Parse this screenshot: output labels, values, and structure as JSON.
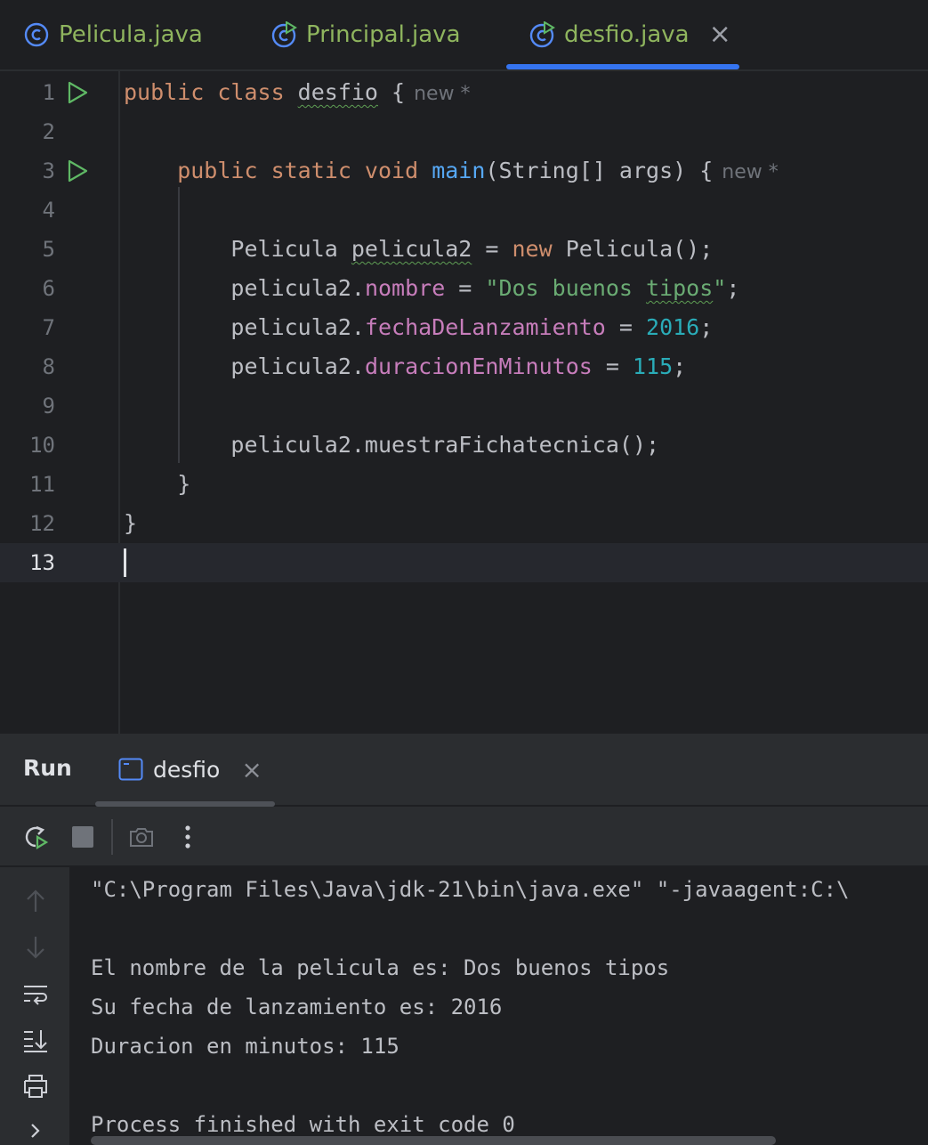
{
  "editor_tabs": [
    {
      "label": "Pelicula.java",
      "icon": "class-icon"
    },
    {
      "label": "Principal.java",
      "icon": "runnable-class-icon"
    },
    {
      "label": "desfio.java",
      "icon": "runnable-class-icon",
      "active": true,
      "close": "×"
    }
  ],
  "editor": {
    "hint": "new *",
    "lines": [
      {
        "n": "1",
        "tokens": [
          {
            "t": "public class ",
            "c": "kw"
          },
          {
            "t": "desfio",
            "c": "plain",
            "squiggle": true
          },
          {
            "t": " {",
            "c": "plain"
          }
        ],
        "hint": true,
        "run": true
      },
      {
        "n": "2",
        "tokens": []
      },
      {
        "n": "3",
        "tokens": [
          {
            "t": "    public static void ",
            "c": "kw"
          },
          {
            "t": "main",
            "c": "fn"
          },
          {
            "t": "(String[] args) {",
            "c": "plain"
          }
        ],
        "hint": true,
        "run": true
      },
      {
        "n": "4",
        "tokens": []
      },
      {
        "n": "5",
        "tokens": [
          {
            "t": "        Pelicula ",
            "c": "plain"
          },
          {
            "t": "pelicula2",
            "c": "plain",
            "squiggle": true
          },
          {
            "t": " = ",
            "c": "plain"
          },
          {
            "t": "new",
            "c": "kw"
          },
          {
            "t": " Pelicula();",
            "c": "plain"
          }
        ]
      },
      {
        "n": "6",
        "tokens": [
          {
            "t": "        pelicula2.",
            "c": "plain"
          },
          {
            "t": "nombre",
            "c": "fld"
          },
          {
            "t": " = ",
            "c": "plain"
          },
          {
            "t": "\"Dos buenos ",
            "c": "str"
          },
          {
            "t": "tipos",
            "c": "str",
            "squiggle": true
          },
          {
            "t": "\"",
            "c": "str"
          },
          {
            "t": ";",
            "c": "plain"
          }
        ]
      },
      {
        "n": "7",
        "tokens": [
          {
            "t": "        pelicula2.",
            "c": "plain"
          },
          {
            "t": "fechaDeLanzamiento",
            "c": "fld"
          },
          {
            "t": " = ",
            "c": "plain"
          },
          {
            "t": "2016",
            "c": "num"
          },
          {
            "t": ";",
            "c": "plain"
          }
        ]
      },
      {
        "n": "8",
        "tokens": [
          {
            "t": "        pelicula2.",
            "c": "plain"
          },
          {
            "t": "duracionEnMinutos",
            "c": "fld"
          },
          {
            "t": " = ",
            "c": "plain"
          },
          {
            "t": "115",
            "c": "num"
          },
          {
            "t": ";",
            "c": "plain"
          }
        ]
      },
      {
        "n": "9",
        "tokens": []
      },
      {
        "n": "10",
        "tokens": [
          {
            "t": "        pelicula2.muestraFichatecnica();",
            "c": "plain"
          }
        ]
      },
      {
        "n": "11",
        "tokens": [
          {
            "t": "    }",
            "c": "plain"
          }
        ]
      },
      {
        "n": "12",
        "tokens": [
          {
            "t": "}",
            "c": "plain"
          }
        ]
      },
      {
        "n": "13",
        "tokens": [],
        "current": true
      }
    ]
  },
  "run_panel": {
    "title": "Run",
    "tab_label": "desfio",
    "tab_close": "×",
    "toolbar": [
      "rerun-icon",
      "stop-icon",
      "camera-icon",
      "more-vertical-icon"
    ],
    "side": [
      "arrow-up-icon",
      "arrow-down-icon",
      "soft-wrap-icon",
      "scroll-to-end-icon",
      "print-icon",
      "chevron-right-icon"
    ],
    "console": [
      "\"C:\\Program Files\\Java\\jdk-21\\bin\\java.exe\" \"-javaagent:C:\\",
      "",
      "El nombre de la pelicula es: Dos buenos tipos",
      "Su fecha de lanzamiento es: 2016",
      "Duracion en minutos: 115",
      "",
      "Process finished with exit code 0"
    ]
  },
  "colors": {
    "accent": "#3574f0",
    "keyword": "#cf8e6d",
    "function": "#56a8f5",
    "field": "#c77dbb",
    "string": "#6aab73",
    "number": "#2aacb8",
    "run_green": "#5fb865"
  }
}
